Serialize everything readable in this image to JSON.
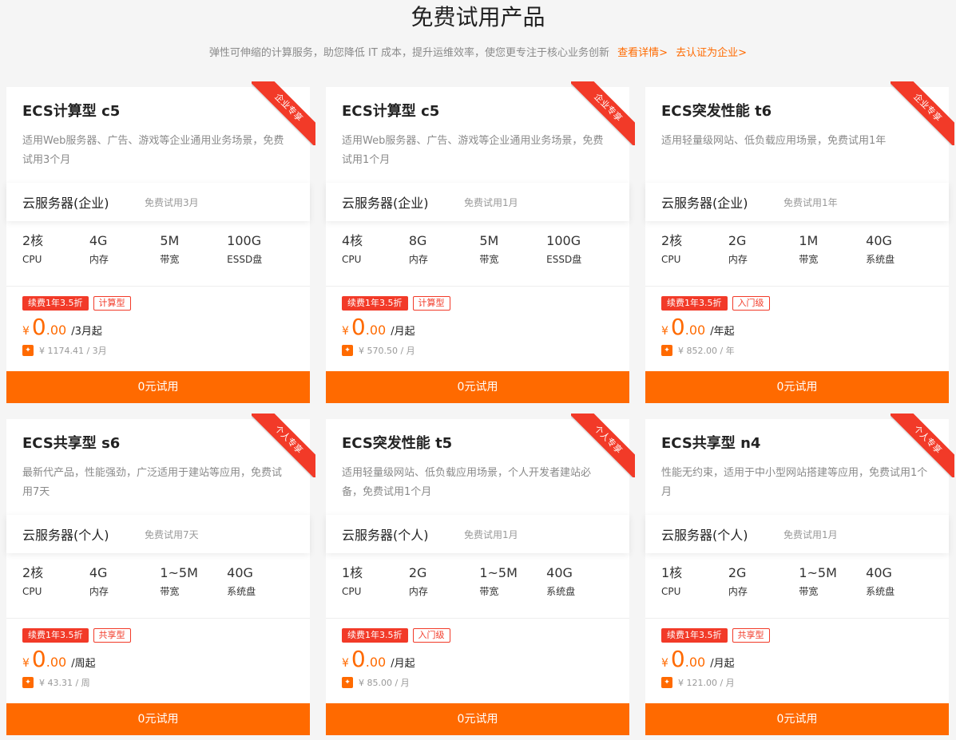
{
  "header": {
    "title": "免费试用产品",
    "subtitle": "弹性可伸缩的计算服务，助您降低 IT 成本，提升运维效率，使您更专注于核心业务创新",
    "link_details": "查看详情>",
    "link_enterprise": "去认证为企业>"
  },
  "colors": {
    "accent": "#ff6a00",
    "ribbon": "#f23a28"
  },
  "cards": [
    {
      "title": "ECS计算型 c5",
      "ribbon": "企业专享",
      "desc": "适用Web服务器、广告、游戏等企业通用业务场景，免费试用3个月",
      "service": "云服务器(企业)",
      "trial": "免费试用3月",
      "specs": [
        {
          "value": "2核",
          "label": "CPU"
        },
        {
          "value": "4G",
          "label": "内存"
        },
        {
          "value": "5M",
          "label": "带宽"
        },
        {
          "value": "100G",
          "label": "ESSD盘"
        }
      ],
      "tag_renew": "续费1年3.5折",
      "tag_type": "计算型",
      "price_yen": "¥",
      "price_int": "0",
      "price_dec": ".00",
      "price_unit": "/3月起",
      "orig_price": "¥ 1174.41 / 3月",
      "button": "0元试用"
    },
    {
      "title": "ECS计算型 c5",
      "ribbon": "企业专享",
      "desc": "适用Web服务器、广告、游戏等企业通用业务场景，免费试用1个月",
      "service": "云服务器(企业)",
      "trial": "免费试用1月",
      "specs": [
        {
          "value": "4核",
          "label": "CPU"
        },
        {
          "value": "8G",
          "label": "内存"
        },
        {
          "value": "5M",
          "label": "带宽"
        },
        {
          "value": "100G",
          "label": "ESSD盘"
        }
      ],
      "tag_renew": "续费1年3.5折",
      "tag_type": "计算型",
      "price_yen": "¥",
      "price_int": "0",
      "price_dec": ".00",
      "price_unit": "/月起",
      "orig_price": "¥ 570.50 / 月",
      "button": "0元试用"
    },
    {
      "title": "ECS突发性能 t6",
      "ribbon": "企业专享",
      "desc": "适用轻量级网站、低负载应用场景，免费试用1年",
      "service": "云服务器(企业)",
      "trial": "免费试用1年",
      "specs": [
        {
          "value": "2核",
          "label": "CPU"
        },
        {
          "value": "2G",
          "label": "内存"
        },
        {
          "value": "1M",
          "label": "带宽"
        },
        {
          "value": "40G",
          "label": "系统盘"
        }
      ],
      "tag_renew": "续费1年3.5折",
      "tag_type": "入门级",
      "price_yen": "¥",
      "price_int": "0",
      "price_dec": ".00",
      "price_unit": "/年起",
      "orig_price": "¥ 852.00 / 年",
      "button": "0元试用"
    },
    {
      "title": "ECS共享型 s6",
      "ribbon": "个人专享",
      "desc": "最新代产品，性能强劲，广泛适用于建站等应用，免费试用7天",
      "service": "云服务器(个人)",
      "trial": "免费试用7天",
      "specs": [
        {
          "value": "2核",
          "label": "CPU"
        },
        {
          "value": "4G",
          "label": "内存"
        },
        {
          "value": "1~5M",
          "label": "带宽"
        },
        {
          "value": "40G",
          "label": "系统盘"
        }
      ],
      "tag_renew": "续费1年3.5折",
      "tag_type": "共享型",
      "price_yen": "¥",
      "price_int": "0",
      "price_dec": ".00",
      "price_unit": "/周起",
      "orig_price": "¥ 43.31 / 周",
      "button": "0元试用"
    },
    {
      "title": "ECS突发性能 t5",
      "ribbon": "个人专享",
      "desc": "适用轻量级网站、低负载应用场景，个人开发者建站必备，免费试用1个月",
      "service": "云服务器(个人)",
      "trial": "免费试用1月",
      "specs": [
        {
          "value": "1核",
          "label": "CPU"
        },
        {
          "value": "2G",
          "label": "内存"
        },
        {
          "value": "1~5M",
          "label": "带宽"
        },
        {
          "value": "40G",
          "label": "系统盘"
        }
      ],
      "tag_renew": "续费1年3.5折",
      "tag_type": "入门级",
      "price_yen": "¥",
      "price_int": "0",
      "price_dec": ".00",
      "price_unit": "/月起",
      "orig_price": "¥ 85.00 / 月",
      "button": "0元试用"
    },
    {
      "title": "ECS共享型 n4",
      "ribbon": "个人专享",
      "desc": "性能无约束，适用于中小型网站搭建等应用，免费试用1个月",
      "service": "云服务器(个人)",
      "trial": "免费试用1月",
      "specs": [
        {
          "value": "1核",
          "label": "CPU"
        },
        {
          "value": "2G",
          "label": "内存"
        },
        {
          "value": "1~5M",
          "label": "带宽"
        },
        {
          "value": "40G",
          "label": "系统盘"
        }
      ],
      "tag_renew": "续费1年3.5折",
      "tag_type": "共享型",
      "price_yen": "¥",
      "price_int": "0",
      "price_dec": ".00",
      "price_unit": "/月起",
      "orig_price": "¥ 121.00 / 月",
      "button": "0元试用"
    }
  ]
}
